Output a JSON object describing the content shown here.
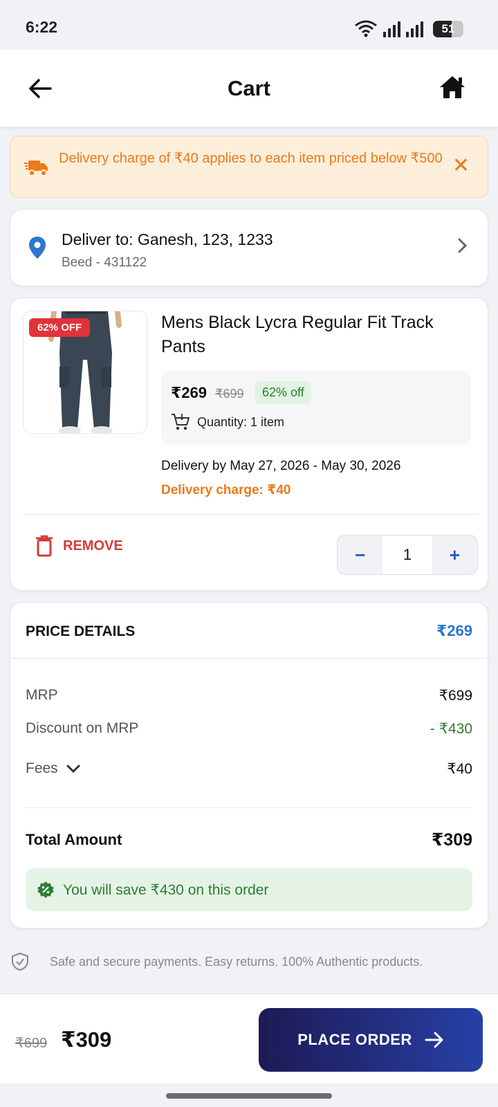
{
  "status_bar": {
    "time": "6:22",
    "battery": "51"
  },
  "header": {
    "title": "Cart"
  },
  "notice": {
    "text": "Delivery charge of ₹40 applies to each item priced below ₹500",
    "close": "✕"
  },
  "address": {
    "title": "Deliver to: Ganesh, 123, 1233",
    "subtitle": "Beed - 431122"
  },
  "product": {
    "badge": "62% OFF",
    "name": "Mens Black Lycra Regular Fit Track Pants",
    "price": "₹269",
    "mrp": "₹699",
    "discount": "62% off",
    "quantity_text": "Quantity: 1 item",
    "delivery_date": "Delivery by May 27, 2026 - May 30, 2026",
    "delivery_charge": "Delivery charge: ₹40",
    "remove_label": "REMOVE",
    "stepper": {
      "minus": "−",
      "value": "1",
      "plus": "+"
    }
  },
  "price_details": {
    "title": "PRICE DETAILS",
    "header_total": "₹269",
    "rows": [
      {
        "label": "MRP",
        "value": "₹699"
      },
      {
        "label": "Discount on MRP",
        "value": "- ₹430"
      },
      {
        "label": "Fees",
        "value": "₹40"
      }
    ],
    "total_label": "Total Amount",
    "total_value": "₹309",
    "savings": "You will save ₹430 on this order"
  },
  "secure_note": "Safe and secure payments. Easy returns. 100% Authentic products.",
  "bottom_bar": {
    "mrp": "₹699",
    "total": "₹309",
    "cta": "PLACE ORDER"
  },
  "colors": {
    "accent_blue": "#2f74d0",
    "cta_start": "#1d1a55",
    "cta_end": "#2740a6",
    "discount_green": "#2e7d32",
    "warning_orange": "#ea7a1a",
    "remove_red": "#d63a3a"
  },
  "icons": [
    "wifi-icon",
    "signal-icon",
    "battery-icon",
    "back-arrow-icon",
    "home-icon",
    "truck-icon",
    "close-icon",
    "location-pin-icon",
    "chevron-right-icon",
    "cart-icon",
    "trash-icon",
    "chevron-down-icon",
    "badge-percent-icon",
    "shield-icon",
    "arrow-right-icon"
  ]
}
